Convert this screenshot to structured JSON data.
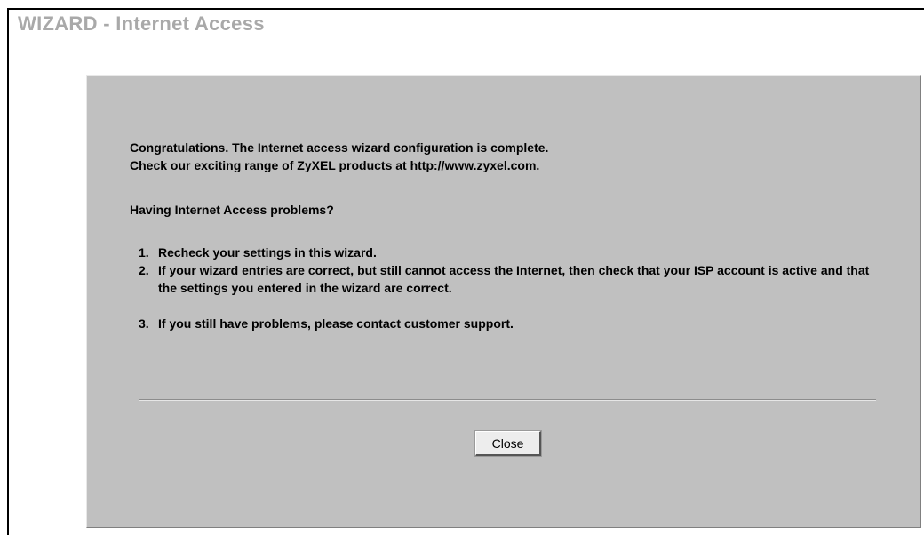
{
  "page": {
    "title": "WIZARD - Internet Access"
  },
  "panel": {
    "intro": [
      "Congratulations. The Internet access wizard configuration is complete.",
      "Check our exciting range of ZyXEL products at http://www.zyxel.com."
    ],
    "question": "Having Internet Access problems?",
    "steps": [
      {
        "num": "1.",
        "text": "Recheck your settings in this wizard."
      },
      {
        "num": "2.",
        "text": "If your wizard entries are correct, but still cannot access the Internet, then check that your ISP account is active and that the settings you entered in the wizard are correct."
      },
      {
        "num": "3.",
        "text": "If you still have problems, please contact customer support."
      }
    ],
    "close_label": "Close"
  },
  "colors": {
    "title": "#a9a9a9",
    "panel_bg": "#c0c0c0",
    "button_bg": "#ededed"
  }
}
